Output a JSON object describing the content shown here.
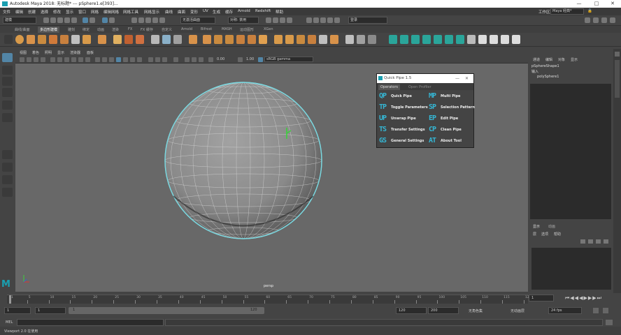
{
  "window": {
    "title": "Autodesk Maya 2018: 无标题*   ---   pSphere1.e[393]...",
    "minimize": "—",
    "maximize": "□",
    "close": "✕"
  },
  "menubar": {
    "items": [
      "文件",
      "编辑",
      "创建",
      "选择",
      "修改",
      "显示",
      "窗口",
      "网格",
      "编辑网格",
      "网格工具",
      "网格显示",
      "曲线",
      "曲面",
      "变形",
      "UV",
      "生成",
      "缓存",
      "Arnold",
      "Redshift",
      "帮助"
    ],
    "workspace_label": "工作区:",
    "workspace_value": "Maya 经典*"
  },
  "statusline": {
    "mode": "建模",
    "symmetry": "无激活曲面",
    "live": "对称: 禁用",
    "login": "登录"
  },
  "shelf_tabs": [
    "曲线/曲面",
    "多边形建模",
    "雕刻",
    "绑定",
    "动画",
    "渲染",
    "FX",
    "FX 缓存",
    "自定义",
    "Arnold",
    "Bifrost",
    "MASH",
    "运动图形",
    "XGen"
  ],
  "shelf_active_tab": "多边形建模",
  "viewport": {
    "menus": [
      "视图",
      "着色",
      "照明",
      "显示",
      "渲染器",
      "面板"
    ],
    "field_a": "0.00",
    "field_b": "1.00",
    "color_space": "sRGB gamma",
    "camera": "persp"
  },
  "quick_pipe": {
    "title": "Quick Pipe 1.5",
    "minimize": "—",
    "close": "✕",
    "tabs": [
      "Operators",
      "Open Profiler"
    ],
    "items": [
      {
        "abbr": "QP",
        "label": "Quick Pipe"
      },
      {
        "abbr": "MP",
        "label": "Multi Pipe"
      },
      {
        "abbr": "TP",
        "label": "Toggle Parameters"
      },
      {
        "abbr": "SP",
        "label": "Selection Pattern"
      },
      {
        "abbr": "UP",
        "label": "Unwrap Pipe"
      },
      {
        "abbr": "EP",
        "label": "Edit Pipe"
      },
      {
        "abbr": "TS",
        "label": "Transfer Settings"
      },
      {
        "abbr": "CP",
        "label": "Clean Pipe"
      },
      {
        "abbr": "GS",
        "label": "General Settings"
      },
      {
        "abbr": "AT",
        "label": "About Tool"
      }
    ]
  },
  "channel_box": {
    "menus": [
      "通道",
      "编辑",
      "对象",
      "显示"
    ],
    "shape_node": "pSphereShape1",
    "inputs_label": "输入",
    "input_node": "polySphere1",
    "layer_tabs": [
      "显示",
      "动画"
    ],
    "layer_menus": [
      "层",
      "选项",
      "帮助"
    ]
  },
  "time_slider": {
    "ticks": [
      "1",
      "5",
      "10",
      "15",
      "20",
      "25",
      "30",
      "35",
      "40",
      "45",
      "50",
      "55",
      "60",
      "65",
      "70",
      "75",
      "80",
      "85",
      "90",
      "95",
      "100",
      "105",
      "110",
      "115",
      "120"
    ],
    "current_frame": "1"
  },
  "range": {
    "start": "1",
    "anim_start": "1",
    "range_start": "1",
    "range_end": "120",
    "anim_end": "120",
    "end": "200",
    "character_set": "无角色集",
    "anim_layer": "无动画层",
    "fps": "24 fps"
  },
  "mel": {
    "label": "MEL"
  },
  "helpline": {
    "text": "Viewport 2.0 在使用"
  },
  "colors": {
    "accent": "#35b6d4",
    "wire": "#7ad8e0",
    "selected_tool": "#5285a6"
  }
}
